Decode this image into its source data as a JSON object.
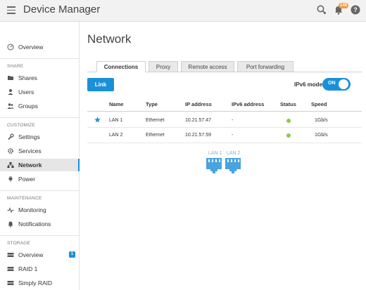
{
  "header": {
    "app_title": "Device Manager",
    "notification_count": "148"
  },
  "sidebar": {
    "overview": "Overview",
    "sections": {
      "share": "SHARE",
      "customize": "CUSTOMIZE",
      "maintenance": "MAINTENANCE",
      "storage": "STORAGE"
    },
    "share_items": [
      "Shares",
      "Users",
      "Groups"
    ],
    "customize_items": [
      "Settings",
      "Services",
      "Network",
      "Power"
    ],
    "maintenance_items": [
      "Monitoring",
      "Notifications"
    ],
    "storage_items": [
      "Overview",
      "RAID 1",
      "Simply RAID"
    ],
    "storage_overview_badge": "1",
    "active_item": "Network",
    "accent_color": "#1a90d8"
  },
  "main": {
    "page_title": "Network",
    "tabs": [
      "Connections",
      "Proxy",
      "Remote access",
      "Port forwarding"
    ],
    "active_tab": "Connections",
    "link_button": "Link",
    "ipv6_mode_label": "IPv6 mode",
    "ipv6_toggle_text": "ON",
    "ipv6_enabled": true,
    "table": {
      "columns": [
        "Name",
        "Type",
        "IP address",
        "IPv6 address",
        "Status",
        "Speed"
      ],
      "rows": [
        {
          "starred": true,
          "name": "LAN 1",
          "type": "Ethernet",
          "ip": "10.21.57.47",
          "ipv6": "-",
          "status": "connected",
          "speed": "1Gb/s"
        },
        {
          "starred": false,
          "name": "LAN 2",
          "type": "Ethernet",
          "ip": "10.21.57.59",
          "ipv6": "-",
          "status": "connected",
          "speed": "1Gb/s"
        }
      ]
    },
    "ports": [
      "LAN 1",
      "LAN 2"
    ],
    "status_color": "#8fc840",
    "port_color": "#4aa3df"
  }
}
